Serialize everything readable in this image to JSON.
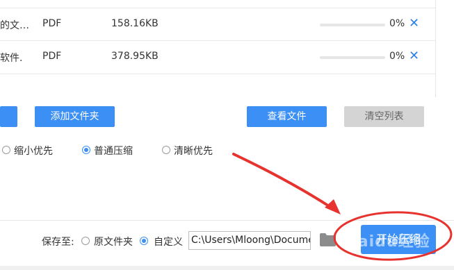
{
  "file_list": [
    {
      "name": "的文…",
      "type": "PDF",
      "size": "158.16KB",
      "progress": 0,
      "percent": "0%",
      "remove_icon": "✕"
    },
    {
      "name": "软件.",
      "type": "PDF",
      "size": "378.95KB",
      "progress": 0,
      "percent": "0%",
      "remove_icon": "✕"
    }
  ],
  "toolbar": {
    "add_folder_label": "添加文件夹",
    "view_files_label": "查看文件",
    "clear_list_label": "清空列表"
  },
  "compression": {
    "options": [
      "缩小优先",
      "普通压缩",
      "清晰优先"
    ],
    "selected": "普通压缩"
  },
  "save_to": {
    "label": "保存至:",
    "options": [
      "原文件夹",
      "自定义"
    ],
    "selected": "自定义",
    "path": "C:\\Users\\Mloong\\Docume"
  },
  "start_button_label": "开始压缩",
  "watermark": "Baidu经验",
  "colors": {
    "accent": "#3b8ff5",
    "annotation_red": "#e8322e",
    "disabled_button": "#d4d4d4"
  }
}
